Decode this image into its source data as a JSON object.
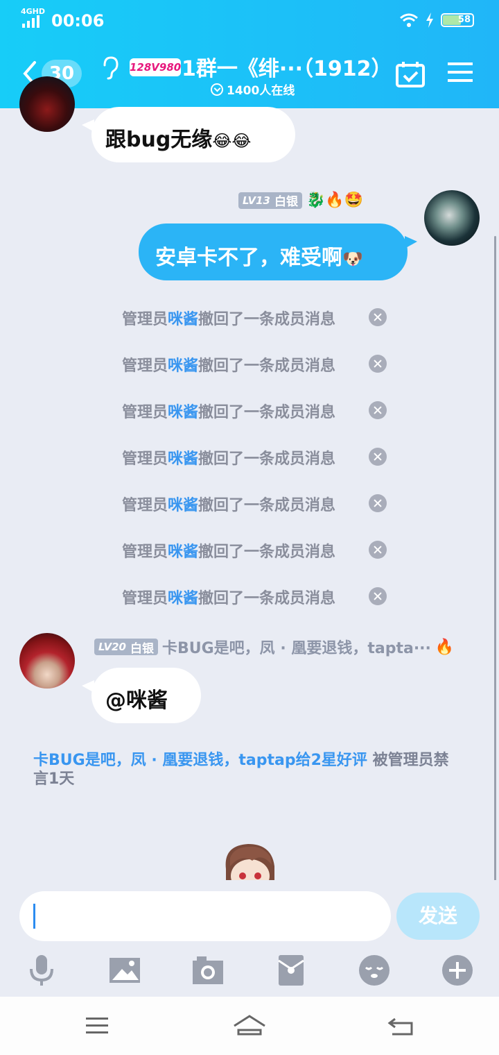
{
  "statusbar": {
    "network": "4GHD",
    "time": "00:06",
    "battery": "58"
  },
  "header": {
    "unread_count": "30",
    "group_logo": "128V980",
    "group_title": "1群一《绯···（1912）",
    "online_count": "1400人在线"
  },
  "messages": {
    "m1": {
      "text": "跟bug无缘",
      "emoji": "😂😂"
    },
    "m2": {
      "level": "LV13",
      "rank": "白银",
      "badges": "🐉🔥🤩",
      "text": "安卓卡不了，难受啊",
      "emoji": "🐶"
    },
    "recalls": [
      {
        "prefix": "管理员",
        "name": "咪酱",
        "suffix": "撤回了一条成员消息"
      },
      {
        "prefix": "管理员",
        "name": "咪酱",
        "suffix": "撤回了一条成员消息"
      },
      {
        "prefix": "管理员",
        "name": "咪酱",
        "suffix": "撤回了一条成员消息"
      },
      {
        "prefix": "管理员",
        "name": "咪酱",
        "suffix": "撤回了一条成员消息"
      },
      {
        "prefix": "管理员",
        "name": "咪酱",
        "suffix": "撤回了一条成员消息"
      },
      {
        "prefix": "管理员",
        "name": "咪酱",
        "suffix": "撤回了一条成员消息"
      },
      {
        "prefix": "管理员",
        "name": "咪酱",
        "suffix": "撤回了一条成员消息"
      }
    ],
    "m3": {
      "level": "LV20",
      "rank": "白银",
      "nickname": "卡BUG是吧，凤 · 凰要退钱，tapta···",
      "badge": "🔥",
      "text": "@咪酱"
    },
    "ban_notice": {
      "highlight": "卡BUG是吧，凤 · 凰要退钱，taptap给2星好评",
      "rest": " 被管理员禁言1天"
    }
  },
  "input": {
    "placeholder": "",
    "send_label": "发送"
  },
  "colors": {
    "header": "#1ec4f8",
    "accent": "#2bb4f6",
    "name": "#3996f0"
  }
}
